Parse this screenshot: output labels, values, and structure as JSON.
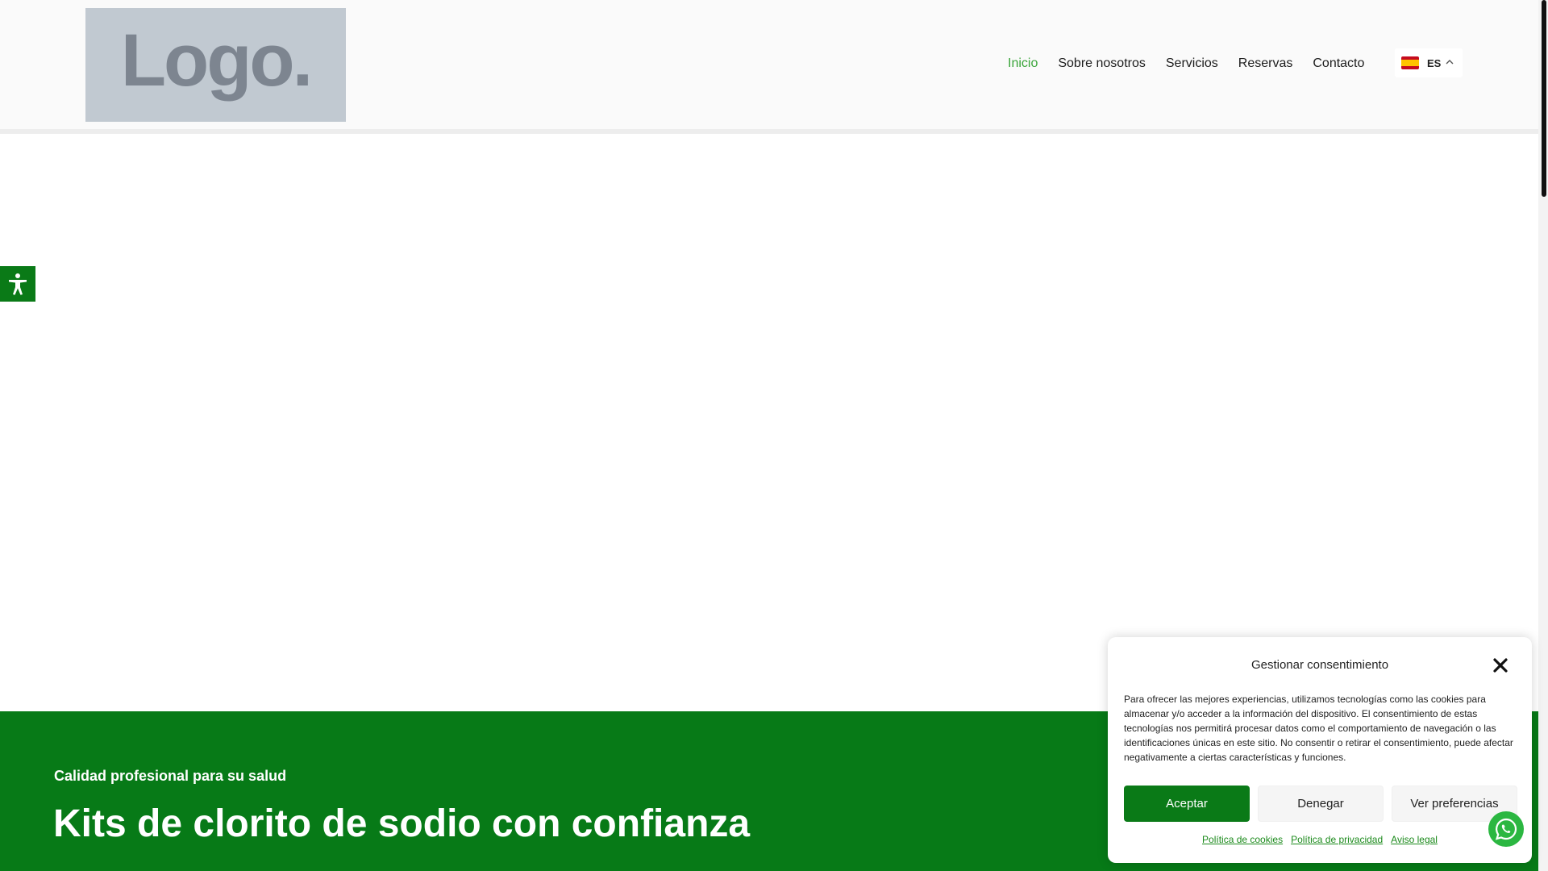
{
  "header": {
    "logo_text": "Logo.",
    "nav": [
      {
        "label": "Inicio",
        "active": true
      },
      {
        "label": "Sobre nosotros",
        "active": false
      },
      {
        "label": "Servicios",
        "active": false
      },
      {
        "label": "Reservas",
        "active": false
      },
      {
        "label": "Contacto",
        "active": false
      }
    ],
    "language": "ES",
    "language_flag_icon": "spain-flag-icon"
  },
  "hero": {
    "kicker": "Calidad profesional para su salud",
    "title": "Kits de clorito de sodio con confianza"
  },
  "cookie_dialog": {
    "title": "Gestionar consentimiento",
    "text": "Para ofrecer las mejores experiencias, utilizamos tecnologías como las cookies para almacenar y/o acceder a la información del dispositivo. El consentimiento de estas tecnologías nos permitirá procesar datos como el comportamiento de navegación o las identificaciones únicas en este sitio. No consentir o retirar el consentimiento, puede afectar negativamente a ciertas características y funciones.",
    "accept_label": "Aceptar",
    "deny_label": "Denegar",
    "preferences_label": "Ver preferencias",
    "links": [
      "Política de cookies",
      "Política de privacidad",
      "Aviso legal"
    ]
  },
  "colors": {
    "brand_green": "#0a7a17",
    "nav_active": "#3aa53a",
    "whatsapp": "#2bb741"
  },
  "icons": {
    "accessibility": "accessibility-icon",
    "close": "close-icon",
    "whatsapp": "whatsapp-icon",
    "chevron": "chevron-up-icon"
  }
}
